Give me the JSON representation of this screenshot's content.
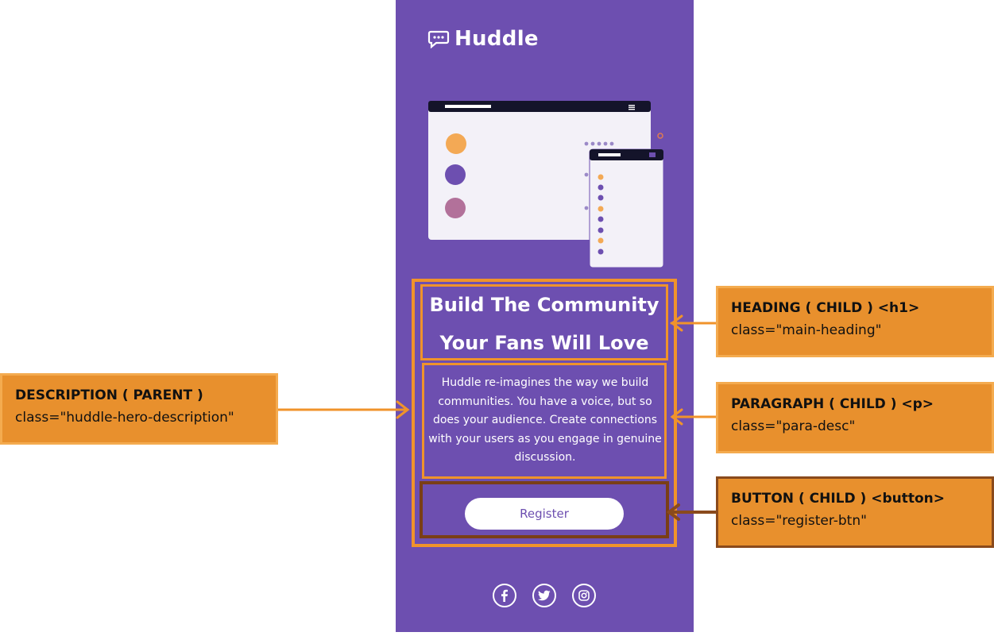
{
  "brand": {
    "name": "Huddle"
  },
  "hero": {
    "heading_line1": "Build The Community",
    "heading_line2": "Your Fans Will Love",
    "description": "Huddle re-imagines the way we build communities. You have a voice, but so does your audience. Create connections with your users as you engage in genuine discussion.",
    "register_label": "Register"
  },
  "social": [
    {
      "icon": "facebook-icon"
    },
    {
      "icon": "twitter-icon"
    },
    {
      "icon": "instagram-icon"
    }
  ],
  "annotations": {
    "heading": {
      "title": "HEADING ( CHILD ) <h1>",
      "class": "class=\"main-heading\""
    },
    "paragraph": {
      "title": "PARAGRAPH ( CHILD ) <p>",
      "class": "class=\"para-desc\""
    },
    "button": {
      "title": "BUTTON ( CHILD ) <button>",
      "class": "class=\"register-btn\""
    },
    "description": {
      "title": "DESCRIPTION ( PARENT )",
      "class": "class=\"huddle-hero-description\""
    }
  },
  "colors": {
    "panel": "#6d4fb0",
    "callout": "#e8902d",
    "outline": "#f0932b",
    "button_outline": "#7a3e16",
    "text_white": "#ffffff"
  }
}
